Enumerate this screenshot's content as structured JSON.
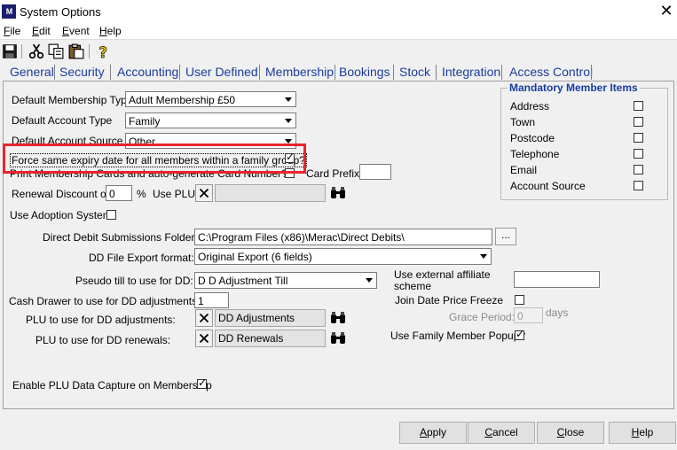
{
  "window": {
    "logo": "M",
    "title": "System Options",
    "close": "✕"
  },
  "menu": [
    {
      "key": "F",
      "rest": "ile"
    },
    {
      "key": "E",
      "rest": "dit"
    },
    {
      "key": "E",
      "rest": "vent"
    },
    {
      "key": "H",
      "rest": "elp"
    }
  ],
  "tabs": [
    "General",
    "Security",
    "Accounting",
    "User Defined",
    "Membership",
    "Bookings",
    "Stock",
    "Integration",
    "Access Control"
  ],
  "active_tab": "Membership",
  "form": {
    "default_membership_type": {
      "label": "Default Membership Type",
      "value": "Adult Membership £50"
    },
    "default_account_type": {
      "label": "Default Account Type",
      "value": "Family"
    },
    "default_account_source": {
      "label": "Default Account Source",
      "value": "Other"
    },
    "force_expiry": {
      "label": "Force same expiry date for all members within a family group?",
      "checked": true
    },
    "print_card": {
      "label": "Print Membership Cards and auto-generate Card Number?",
      "checked": false
    },
    "card_prefix": {
      "label": "Card Prefix:",
      "value": ""
    },
    "renewal_discount": {
      "label": "Renewal Discount of:",
      "value": "0",
      "unit": "%"
    },
    "use_plu": {
      "label": "Use PLU:",
      "value": ""
    },
    "use_adoption": {
      "label": "Use Adoption System",
      "checked": false
    },
    "dd_folder": {
      "label": "Direct Debit Submissions Folder:",
      "value": "C:\\Program Files (x86)\\Merac\\Direct Debits\\",
      "browse": "..."
    },
    "dd_format": {
      "label": "DD File Export format:",
      "value": "Original Export (6 fields)"
    },
    "pseudo_till": {
      "label": "Pseudo till to use for DD:",
      "value": "D D Adjustment Till"
    },
    "cash_drawer": {
      "label": "Cash Drawer to use for DD adjustments:",
      "value": "1"
    },
    "plu_adjustments": {
      "label": "PLU to use for DD adjustments:",
      "value": "DD Adjustments"
    },
    "plu_renewals": {
      "label": "PLU to use for DD renewals:",
      "value": "DD Renewals"
    },
    "external_affiliate": {
      "label1": "Use external affiliate",
      "label2": "scheme",
      "value": ""
    },
    "join_date_freeze": {
      "label": "Join Date Price Freeze",
      "checked": false
    },
    "grace_period": {
      "label": "Grace Period:",
      "value": "0",
      "unit": "days"
    },
    "family_popup": {
      "label": "Use Family Member Popup?",
      "checked": true
    },
    "plu_capture": {
      "label": "Enable PLU Data Capture on Membership",
      "checked": true
    }
  },
  "mandatory": {
    "title": "Mandatory Member Items",
    "items": [
      {
        "label": "Address",
        "checked": false
      },
      {
        "label": "Town",
        "checked": false
      },
      {
        "label": "Postcode",
        "checked": false
      },
      {
        "label": "Telephone",
        "checked": false
      },
      {
        "label": "Email",
        "checked": false
      },
      {
        "label": "Account Source",
        "checked": false
      }
    ]
  },
  "buttons": [
    {
      "key": "A",
      "rest": "pply"
    },
    {
      "key": "C",
      "rest": "ancel"
    },
    {
      "key": "C",
      "rest": "lose"
    },
    {
      "key": "H",
      "rest": "elp"
    }
  ],
  "check_mark": "✓",
  "colors": {
    "tab_text": "#1a3c9e",
    "highlight": "#e8242b",
    "group_title": "#1a3c9e"
  }
}
